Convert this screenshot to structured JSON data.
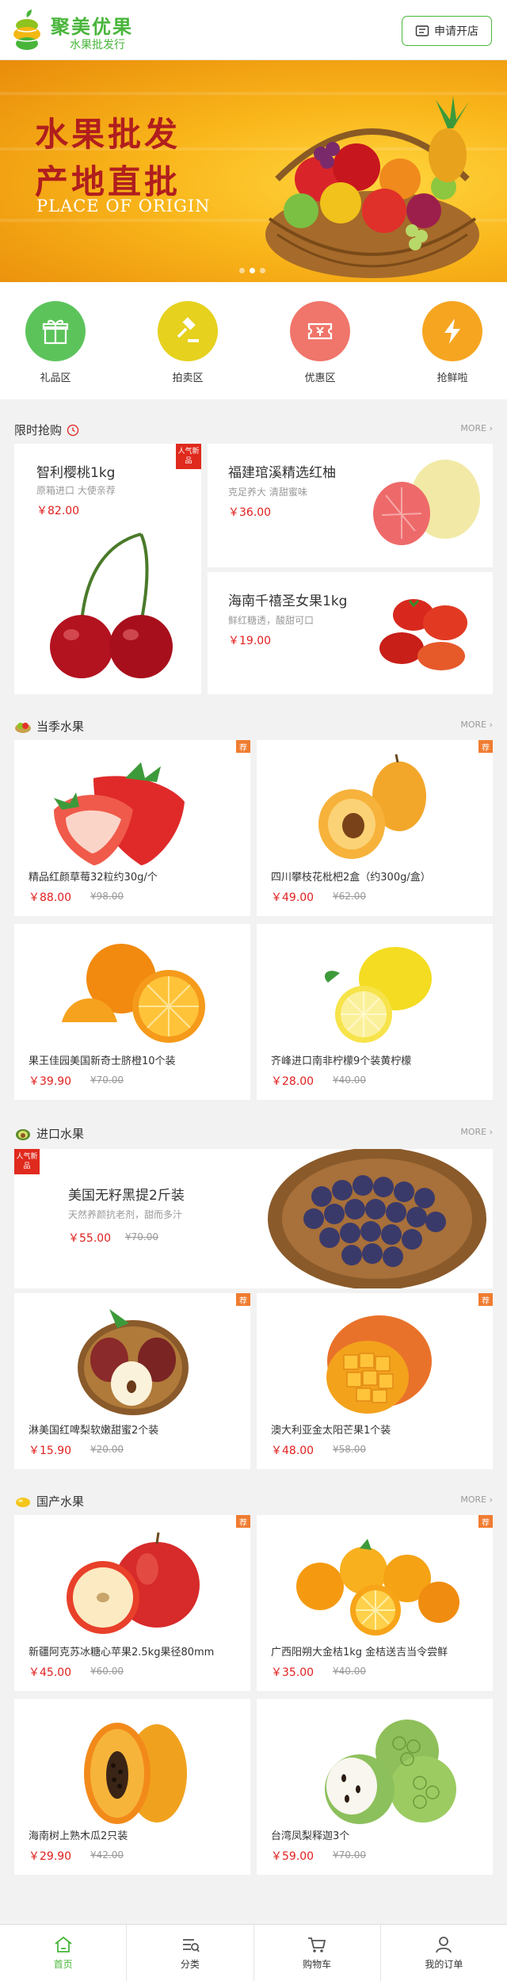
{
  "header": {
    "logo_title": "聚美优果",
    "logo_subtitle": "水果批发行",
    "apply_label": "申请开店"
  },
  "banner": {
    "line1": "水果批发",
    "line2": "产地直批",
    "en": "PLACE OF ORIGIN"
  },
  "categories": [
    {
      "label": "礼品区",
      "color": "#5cc35b",
      "icon": "gift-icon"
    },
    {
      "label": "拍卖区",
      "color": "#e6d11e",
      "icon": "auction-hammer-icon"
    },
    {
      "label": "优惠区",
      "color": "#f0756a",
      "icon": "coupon-icon"
    },
    {
      "label": "抢鲜啦",
      "color": "#f6a521",
      "icon": "lightning-icon"
    }
  ],
  "flash": {
    "title": "限时抢购",
    "more": "MORE",
    "main": {
      "name": "智利樱桃1kg",
      "desc": "原箱进口 大使亲荐",
      "price": "￥82.00",
      "tag": "人气新品"
    },
    "side": [
      {
        "name": "福建琯溪精选红柚",
        "desc": "克足养大  清甜蜜味",
        "price": "￥36.00"
      },
      {
        "name": "海南千禧圣女果1kg",
        "desc": "鲜红糖透，酸甜可口",
        "price": "￥19.00"
      }
    ]
  },
  "season": {
    "title": "当季水果",
    "more": "MORE",
    "items": [
      {
        "name": "精品红颜草莓32粒约30g/个",
        "price": "￥88.00",
        "old": "¥98.00",
        "tag": "荐"
      },
      {
        "name": "四川攀枝花枇杷2盒（约300g/盒）",
        "price": "￥49.00",
        "old": "¥62.00",
        "tag": "荐"
      },
      {
        "name": "果王佳园美国新奇士脐橙10个装",
        "price": "￥39.90",
        "old": "¥70.00"
      },
      {
        "name": "齐峰进口南非柠檬9个装黄柠檬",
        "price": "￥28.00",
        "old": "¥40.00"
      }
    ]
  },
  "imported": {
    "title": "进口水果",
    "more": "MORE",
    "feature": {
      "name": "美国无籽黑提2斤装",
      "desc": "天然养颜抗老剂，甜而多汁",
      "price": "￥55.00",
      "old": "¥70.00",
      "tag": "人气新品"
    },
    "items": [
      {
        "name": "淋美国红啤梨软嫩甜蜜2个装",
        "price": "￥15.90",
        "old": "¥20.00",
        "tag": "荐"
      },
      {
        "name": "澳大利亚金太阳芒果1个装",
        "price": "￥48.00",
        "old": "¥58.00",
        "tag": "荐"
      }
    ]
  },
  "domestic": {
    "title": "国产水果",
    "more": "MORE",
    "items": [
      {
        "name": "新疆阿克苏冰糖心苹果2.5kg果径80mm",
        "price": "￥45.00",
        "old": "¥60.00",
        "tag": "荐"
      },
      {
        "name": "广西阳朔大金桔1kg 金桔送吉当令尝鲜",
        "price": "￥35.00",
        "old": "¥40.00",
        "tag": "荐"
      },
      {
        "name": "海南树上熟木瓜2只装",
        "price": "￥29.90",
        "old": "¥42.00"
      },
      {
        "name": "台湾凤梨释迦3个",
        "price": "￥59.00",
        "old": "¥70.00"
      }
    ]
  },
  "tabbar": [
    {
      "label": "首页",
      "icon": "home-icon"
    },
    {
      "label": "分类",
      "icon": "category-icon"
    },
    {
      "label": "购物车",
      "icon": "cart-icon"
    },
    {
      "label": "我的订单",
      "icon": "user-icon"
    }
  ],
  "colors": {
    "brand": "#48b53a",
    "price": "#e0201e",
    "hot_tag": "#f07c30"
  }
}
